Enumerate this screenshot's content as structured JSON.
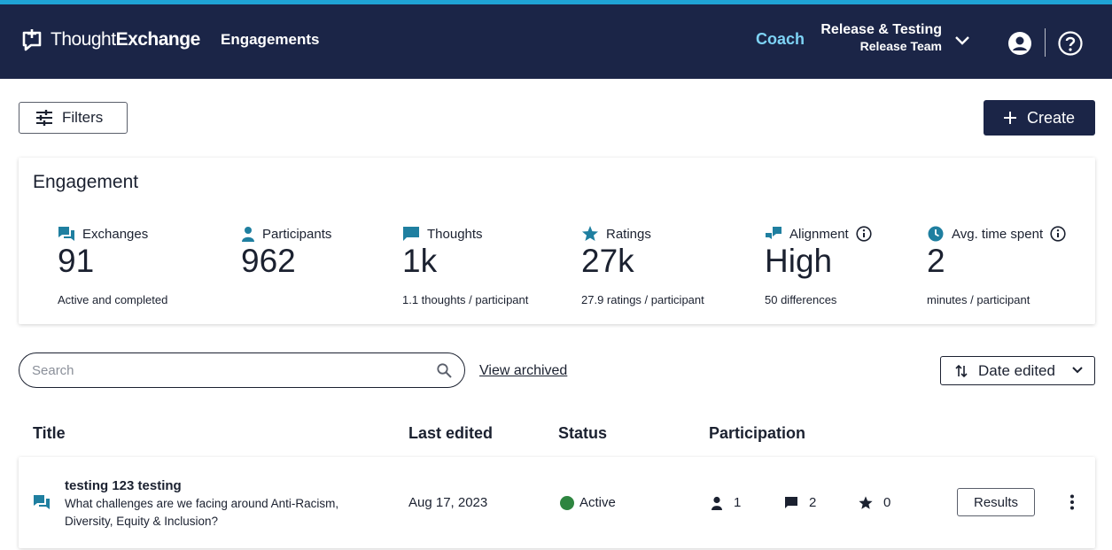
{
  "header": {
    "logo_light": "Thought",
    "logo_bold": "Exchange",
    "nav_engagements": "Engagements",
    "nav_coach": "Coach",
    "team_name": "Release & Testing",
    "team_sub": "Release Team"
  },
  "toolbar": {
    "filters_label": "Filters",
    "create_label": "Create"
  },
  "engagement": {
    "title": "Engagement",
    "stats": [
      {
        "label": "Exchanges",
        "value": "91",
        "sub": "Active and completed",
        "icon": "chat-icon"
      },
      {
        "label": "Participants",
        "value": "962",
        "sub": "",
        "icon": "person-icon"
      },
      {
        "label": "Thoughts",
        "value": "1k",
        "sub": "1.1 thoughts / participant",
        "icon": "comment-icon"
      },
      {
        "label": "Ratings",
        "value": "27k",
        "sub": "27.9 ratings / participant",
        "icon": "star-icon"
      },
      {
        "label": "Alignment",
        "value": "High",
        "sub": "50 differences",
        "icon": "alignment-icon"
      },
      {
        "label": "Avg. time spent",
        "value": "2",
        "sub": "minutes / participant",
        "icon": "clock-icon"
      }
    ]
  },
  "search": {
    "placeholder": "Search",
    "value": ""
  },
  "view_archived": "View archived",
  "sort": {
    "label": "Date edited"
  },
  "table": {
    "headers": {
      "title": "Title",
      "last_edited": "Last edited",
      "status": "Status",
      "participation": "Participation"
    },
    "rows": [
      {
        "title": "testing 123 testing",
        "description": "What challenges are we facing around Anti-Racism, Diversity, Equity & Inclusion?",
        "last_edited": "Aug 17, 2023",
        "status": "Active",
        "participants": "1",
        "thoughts": "2",
        "ratings": "0",
        "results_label": "Results"
      }
    ]
  },
  "colors": {
    "header_bg": "#1b2547",
    "accent_strip": "#1fa3d5",
    "coach": "#7ed3f5",
    "icon_teal": "#1f7fa0",
    "status_active": "#2e8540"
  }
}
